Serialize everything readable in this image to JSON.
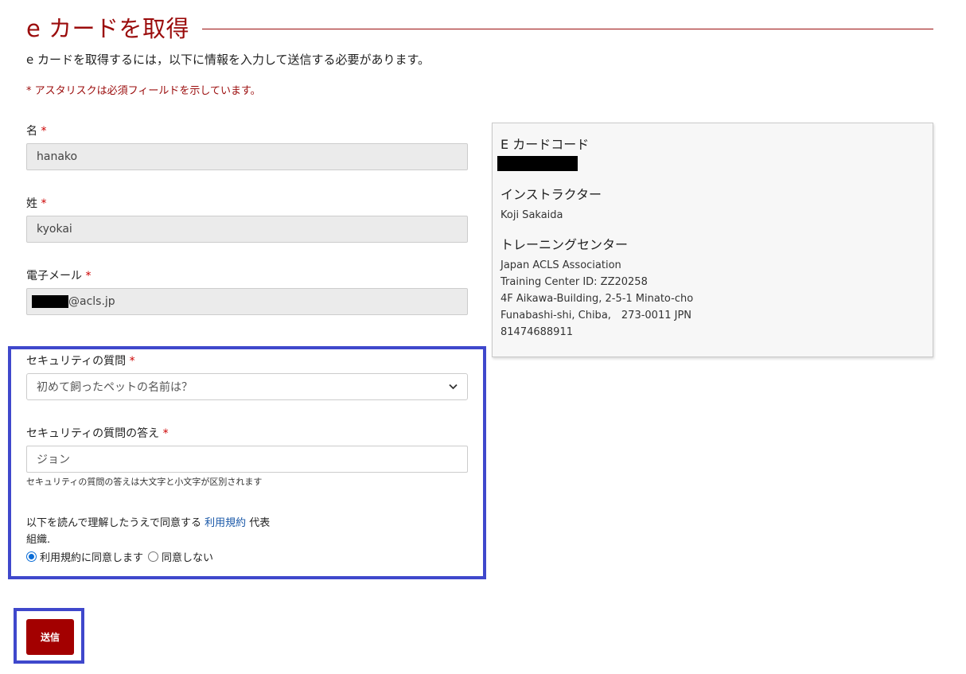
{
  "header": {
    "title": "e カードを取得",
    "intro": "e カードを取得するには，以下に情報を入力して送信する必要があります。",
    "required_note": "* アスタリスクは必須フィールドを示しています。"
  },
  "form": {
    "first_name": {
      "label": "名",
      "required_mark": "*",
      "value": "hanako"
    },
    "last_name": {
      "label": "姓",
      "required_mark": "*",
      "value": "kyokai"
    },
    "email": {
      "label": "電子メール",
      "required_mark": "*",
      "value": "@acls.jp"
    },
    "security_question": {
      "label": "セキュリティの質問",
      "required_mark": "*",
      "selected": "初めて飼ったペットの名前は？"
    },
    "security_answer": {
      "label": "セキュリティの質問の答え",
      "required_mark": "*",
      "value": "ジョン",
      "help": "セキュリティの質問の答えは大文字と小文字が区別されます"
    },
    "terms": {
      "text_before": "以下を読んで理解したうえで同意する",
      "link": "利用規約",
      "text_after": "代表",
      "text_line2": "組織.",
      "agree_label": "利用規約に同意します",
      "disagree_label": "同意しない",
      "agree_selected": true
    },
    "submit_label": "送信"
  },
  "card_panel": {
    "code_heading": "E カードコード",
    "instructor_heading": "インストラクター",
    "instructor_name": "Koji Sakaida",
    "center_heading": "トレーニングセンター",
    "center_lines": [
      "Japan ACLS Association",
      "Training Center ID: ZZ20258",
      "4F Aikawa-Building, 2-5-1 Minato-cho",
      "Funabashi-shi, Chiba,　273-0011 JPN",
      "81474688911"
    ]
  },
  "colors": {
    "title": "#9b0c0c",
    "required": "#cc0000",
    "submit": "#a30000",
    "highlight": "#3f48cc",
    "link": "#1a58a8"
  }
}
